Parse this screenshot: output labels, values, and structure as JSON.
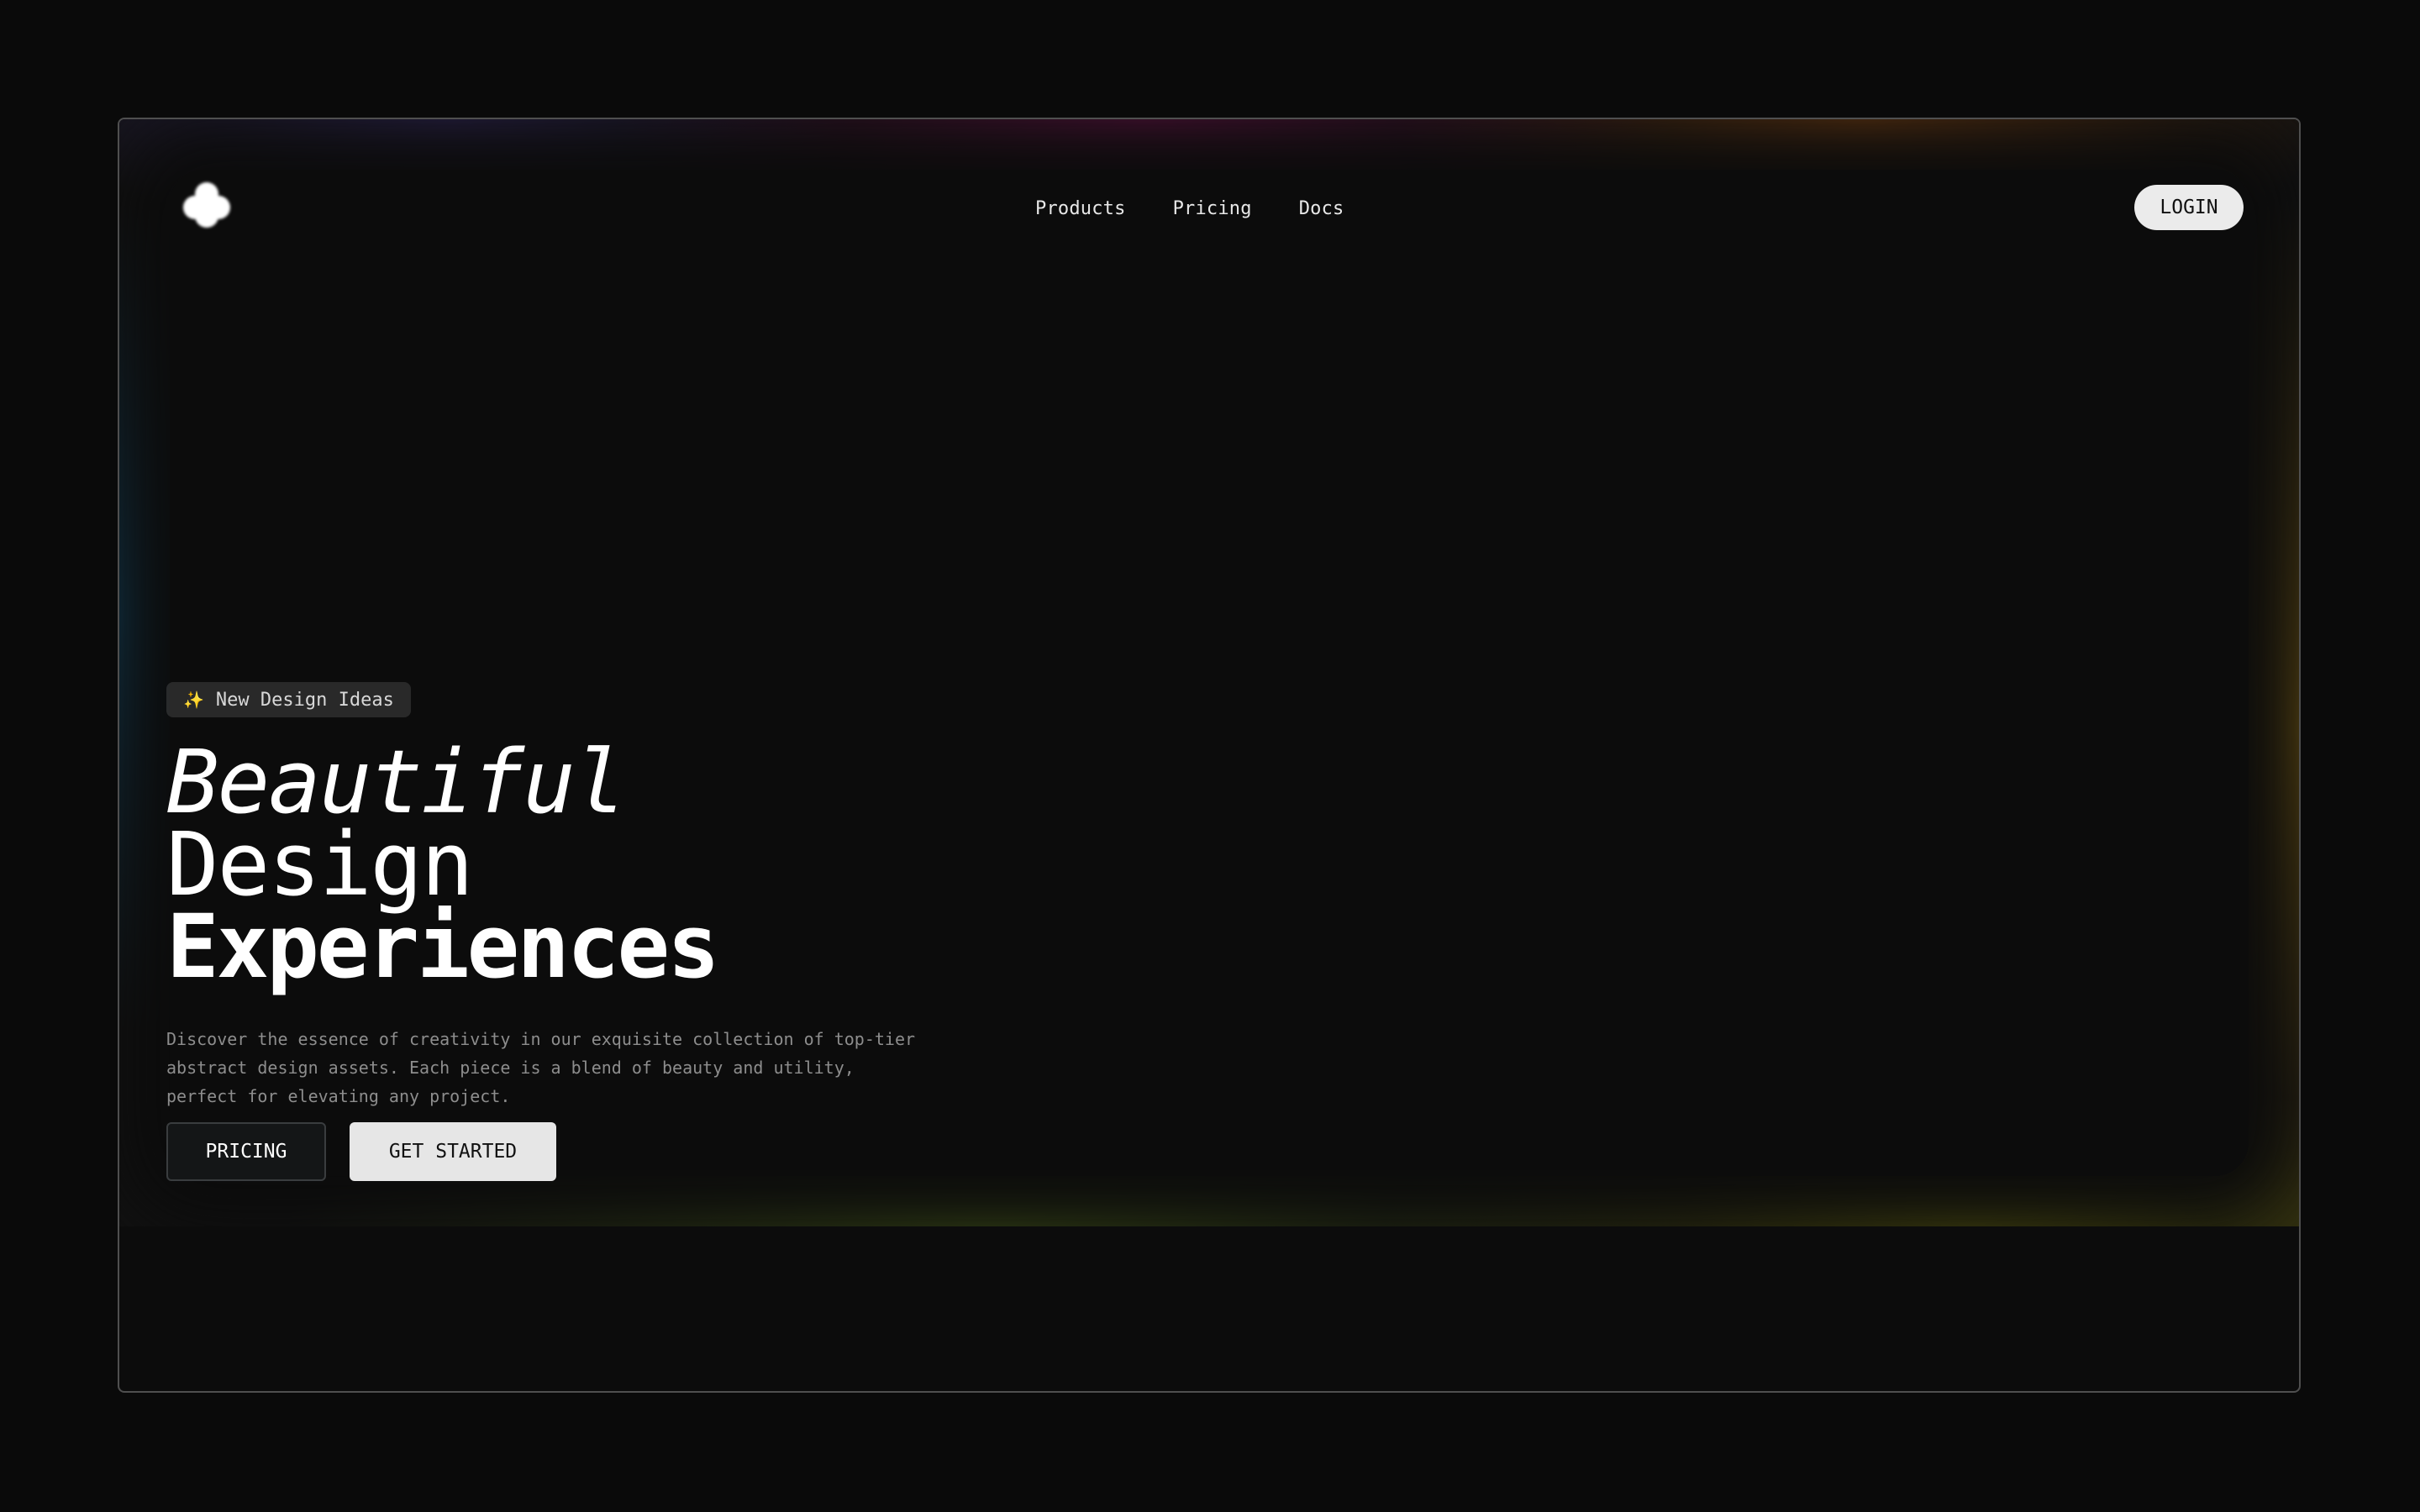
{
  "nav": {
    "items": [
      {
        "label": "Products"
      },
      {
        "label": "Pricing"
      },
      {
        "label": "Docs"
      }
    ],
    "login_label": "LOGIN"
  },
  "hero": {
    "badge_icon": "sparkles-icon",
    "badge_glyph": "✨",
    "badge_text": "New Design Ideas",
    "headline_line1": "Beautiful",
    "headline_line2": "Design",
    "headline_line3": "Experiences",
    "description": "Discover the essence of creativity in our exquisite collection of top-tier abstract design assets. Each piece is a blend of beauty and utility, perfect for elevating any project.",
    "pricing_label": "PRICING",
    "get_started_label": "GET STARTED"
  },
  "colors": {
    "background": "#0a0a0a",
    "panel": "#0c0c0c",
    "button_light": "#e6e6e6",
    "glow_magenta": "#b41478",
    "glow_orange": "#dc6e14",
    "glow_blue": "#146ea0",
    "glow_olive": "#969614"
  }
}
